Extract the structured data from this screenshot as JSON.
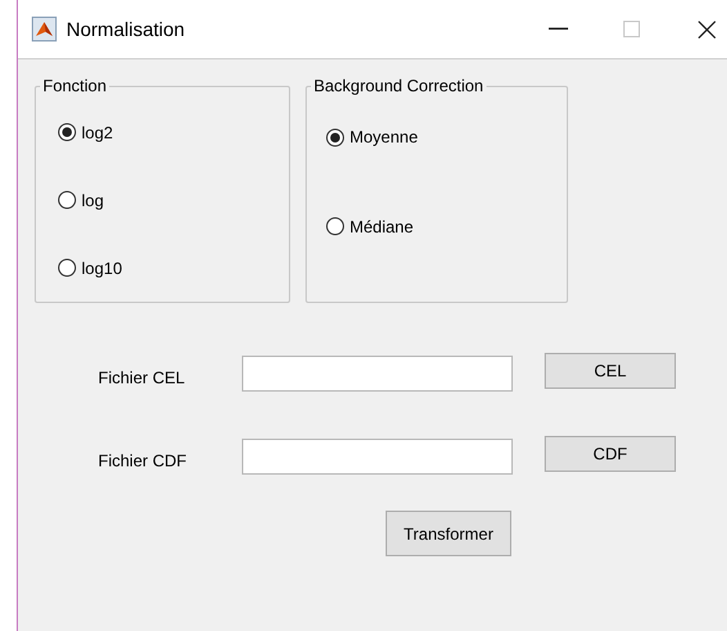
{
  "window": {
    "title": "Normalisation"
  },
  "groups": [
    {
      "title": "Fonction",
      "options": [
        {
          "label": "log2",
          "selected": true
        },
        {
          "label": "log",
          "selected": false
        },
        {
          "label": "log10",
          "selected": false
        }
      ]
    },
    {
      "title": "Background Correction",
      "options": [
        {
          "label": "Moyenne",
          "selected": true
        },
        {
          "label": "Médiane",
          "selected": false
        }
      ]
    }
  ],
  "file_rows": [
    {
      "label": "Fichier CEL",
      "value": "",
      "button": "CEL"
    },
    {
      "label": "Fichier CDF",
      "value": "",
      "button": "CDF"
    }
  ],
  "action_button": "Transformer"
}
